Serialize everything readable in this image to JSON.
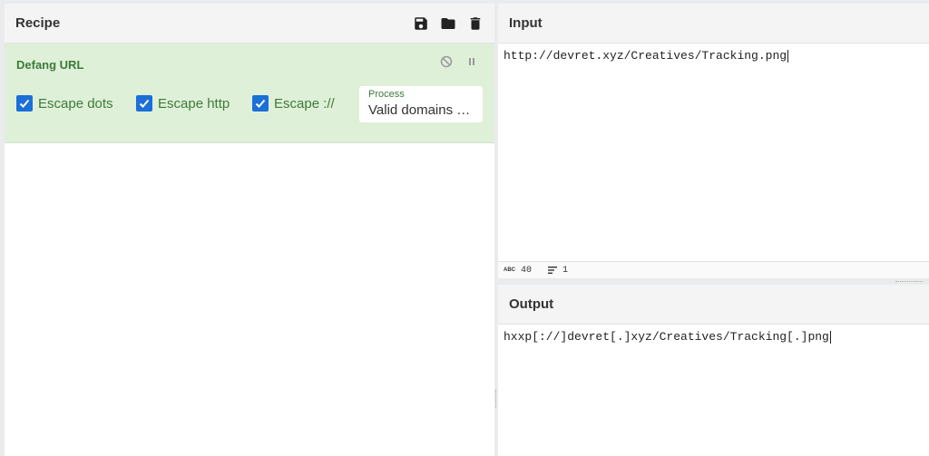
{
  "recipe": {
    "title": "Recipe",
    "icons": [
      "save-icon",
      "folder-icon",
      "trash-icon"
    ],
    "operation": {
      "title": "Defang URL",
      "controls": [
        "disable-icon",
        "pause-icon"
      ],
      "checkboxes": [
        {
          "label": "Escape dots",
          "checked": true
        },
        {
          "label": "Escape http",
          "checked": true
        },
        {
          "label": "Escape ://",
          "checked": true
        }
      ],
      "process": {
        "label": "Process",
        "value": "Valid domains and full URLs"
      }
    }
  },
  "input": {
    "title": "Input",
    "text": "http://devret.xyz/Creatives/Tracking.png",
    "status": {
      "chars": "40",
      "lines": "1"
    }
  },
  "output": {
    "title": "Output",
    "text": "hxxp[://]devret[.]xyz/Creatives/Tracking[.]png"
  },
  "colors": {
    "accent": "#1b6fd8",
    "op_bg": "#dff0d8",
    "op_text": "#3d7a39"
  }
}
